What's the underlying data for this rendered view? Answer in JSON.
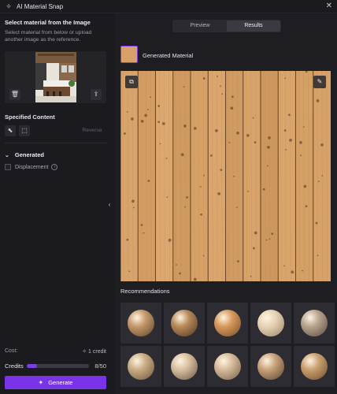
{
  "window": {
    "title": "AI Material Snap",
    "close_glyph": "✕",
    "app_icon": "sparkle-icon"
  },
  "left_panel": {
    "heading": "Select material from the Image",
    "subtext": "Select material from below or upload another image as the reference.",
    "reference": {
      "delete_icon": "trash-icon",
      "upload_icon": "upload-icon"
    },
    "specified_content_label": "Specified Content",
    "tools": [
      {
        "name": "pointer-tool",
        "glyph": "⬉"
      },
      {
        "name": "marquee-tool",
        "glyph": "⬚"
      }
    ],
    "reverse_label": "Reverse",
    "generated_section": {
      "label": "Generated",
      "chevron": "⌄"
    },
    "displacement_label": "Displacement",
    "info_glyph": "i",
    "cost_label": "Cost:",
    "cost_value": "1 credit",
    "credits_label": "Credits",
    "credits_used": 8,
    "credits_total": 50,
    "credits_text": "8/50",
    "generate_label": "Generate"
  },
  "right_panel": {
    "tabs": [
      {
        "label": "Preview",
        "active": false
      },
      {
        "label": "Results",
        "active": true
      }
    ],
    "generated_material_label": "Generated Material",
    "recommendations_label": "Recommendations"
  },
  "colors": {
    "accent": "#7a34e8",
    "wood": "#d7a169",
    "panel_bg": "#1b1b1f"
  },
  "recommendations": [
    {
      "name": "sphere-wood-1",
      "base": "#c49a6c",
      "dark": "#5e4128"
    },
    {
      "name": "sphere-wood-2",
      "base": "#b88a5a",
      "dark": "#4d3521"
    },
    {
      "name": "sphere-wood-3",
      "base": "#d79a5c",
      "dark": "#7a4a25"
    },
    {
      "name": "sphere-wood-4",
      "base": "#e7d3b6",
      "dark": "#9c8468"
    },
    {
      "name": "sphere-wood-5",
      "base": "#b8a58f",
      "dark": "#5a4a3b"
    },
    {
      "name": "sphere-wood-6",
      "base": "#c9ad86",
      "dark": "#6b5438"
    },
    {
      "name": "sphere-wood-7",
      "base": "#d8c0a0",
      "dark": "#6a5642"
    },
    {
      "name": "sphere-wood-8",
      "base": "#d7bc9b",
      "dark": "#735e49"
    },
    {
      "name": "sphere-wood-9",
      "base": "#c7a27a",
      "dark": "#5b4330"
    },
    {
      "name": "sphere-wood-10",
      "base": "#caa070",
      "dark": "#6b4a2a"
    }
  ]
}
